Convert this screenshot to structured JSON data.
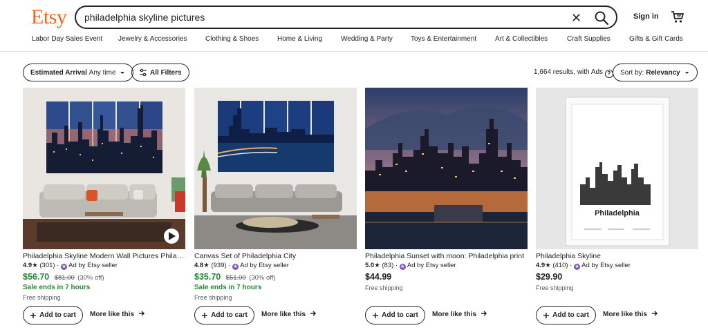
{
  "header": {
    "logo": "Etsy",
    "search_value": "philadelphia skyline pictures",
    "clear_glyph": "✕",
    "signin": "Sign in"
  },
  "nav": [
    "Labor Day Sales Event",
    "Jewelry & Accessories",
    "Clothing & Shoes",
    "Home & Living",
    "Wedding & Party",
    "Toys & Entertainment",
    "Art & Collectibles",
    "Craft Supplies",
    "Gifts & Gift Cards"
  ],
  "filters": {
    "arrival_label": "Estimated Arrival",
    "arrival_value": "Any time",
    "all_filters": "All Filters",
    "results": "1,664 results, with Ads",
    "sort_label": "Sort by:",
    "sort_value": "Relevancy"
  },
  "products": [
    {
      "title": "Philadelphia Skyline Modern Wall Pictures Philadelphia",
      "rating": "4.9",
      "reviews": "(301)",
      "ad": "Ad by Etsy seller",
      "price": "$56.70",
      "original": "$81.00",
      "discount": "(30% off)",
      "sale_ends": "Sale ends in 7 hours",
      "shipping": "Free shipping",
      "add_to_cart": "Add to cart",
      "more_like": "More like this"
    },
    {
      "title": "Canvas Set of Philadelphia City",
      "rating": "4.8",
      "reviews": "(939)",
      "ad": "Ad by Etsy seller",
      "price": "$35.70",
      "original": "$51.00",
      "discount": "(30% off)",
      "sale_ends": "Sale ends in 7 hours",
      "shipping": "Free shipping",
      "add_to_cart": "Add to cart",
      "more_like": "More like this"
    },
    {
      "title": "Philadelphia Sunset with moon: Philadelphia print",
      "rating": "5.0",
      "reviews": "(83)",
      "ad": "Ad by Etsy seller",
      "price": "$44.99",
      "original": "",
      "discount": "",
      "sale_ends": "",
      "shipping": "Free shipping",
      "add_to_cart": "Add to cart",
      "more_like": "More like this"
    },
    {
      "title": "Philadelphia Skyline",
      "rating": "4.9",
      "reviews": "(410)",
      "ad": "Ad by Etsy seller",
      "price": "$29.90",
      "original": "",
      "discount": "",
      "sale_ends": "",
      "shipping": "Free shipping",
      "add_to_cart": "Add to cart",
      "more_like": "More like this",
      "poster_text": "Philadelphia"
    }
  ],
  "colors": {
    "brand": "#f1641e",
    "sale": "#258635",
    "ad_badge": "#7f55c4"
  },
  "icons": [
    "search-icon",
    "clear-icon",
    "cart-icon",
    "chevron-down-icon",
    "filter-icon",
    "help-icon",
    "star-icon",
    "plus-icon",
    "arrow-right-icon",
    "play-icon"
  ]
}
